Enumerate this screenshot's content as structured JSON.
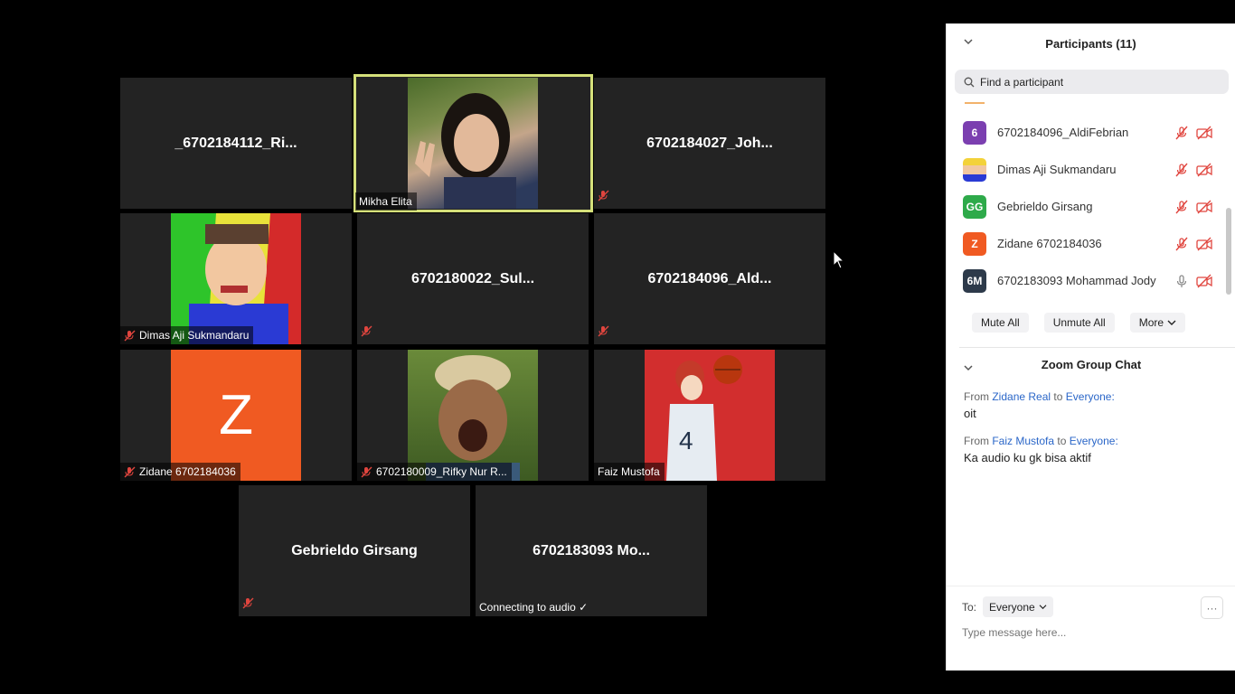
{
  "tiles": {
    "t1_name": "_6702184112_Ri...",
    "t2_label": "Mikha Elita",
    "t3_name": "6702184027_Joh...",
    "t4_label": "Dimas Aji Sukmandaru",
    "t5_name": "6702180022_Sul...",
    "t6_name": "6702184096_Ald...",
    "t7_label": "Zidane 6702184036",
    "t7_avatar_letter": "Z",
    "t8_label": "6702180009_Rifky Nur R...",
    "t9_label": "Faiz Mustofa",
    "t10_name": "Gebrieldo Girsang",
    "t11_name": "6702183093  Mo...",
    "t11_label": "Connecting to audio ✓"
  },
  "panel": {
    "title": "Participants (11)",
    "search_placeholder": "Find a participant",
    "participants": [
      {
        "initials": "6",
        "name": "6702184096_AldiFebrian",
        "color": "#7b3fb0",
        "mic": "mic-muted",
        "video": "video-off"
      },
      {
        "initials": "",
        "name": "Dimas Aji Sukmandaru",
        "color": "#f3d23a",
        "mic": "mic-muted",
        "video": "video-off"
      },
      {
        "initials": "GG",
        "name": "Gebrieldo Girsang",
        "color": "#2eaa4a",
        "mic": "mic-muted",
        "video": "video-off"
      },
      {
        "initials": "Z",
        "name": "Zidane 6702184036",
        "color": "#f05a22",
        "mic": "mic-muted",
        "video": "video-off"
      },
      {
        "initials": "6M",
        "name": "6702183093 Mohammad Jody ...",
        "color": "#2d3a4a",
        "mic": "mic-on",
        "video": "video-off"
      }
    ],
    "mute_all": "Mute All",
    "unmute_all": "Unmute All",
    "more": "More"
  },
  "chat": {
    "title": "Zoom Group Chat",
    "messages": [
      {
        "from_prefix": "From",
        "sender": "Zidane Real",
        "to_word": "to",
        "recipient": "Everyone:",
        "text": "oit"
      },
      {
        "from_prefix": "From",
        "sender": "Faiz Mustofa",
        "to_word": "to",
        "recipient": "Everyone:",
        "text": "Ka audio ku gk bisa aktif"
      }
    ],
    "to_label": "To:",
    "to_value": "Everyone",
    "more_dots": "···",
    "input_placeholder": "Type message here..."
  },
  "colors": {
    "active_speaker": "#d5e07a",
    "tile_bg": "#232323",
    "mute_red": "#e0453e",
    "link_blue": "#2a66c8"
  }
}
